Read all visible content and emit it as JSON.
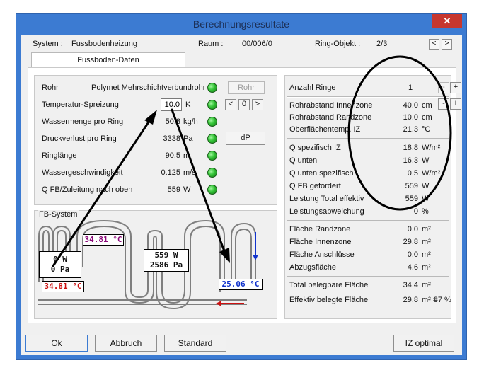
{
  "window": {
    "title": "Berechnungsresultate",
    "close_glyph": "✕"
  },
  "header": {
    "system_label": "System :",
    "system_value": "Fussbodenheizung",
    "raum_label": "Raum :",
    "raum_value": "00/006/0",
    "ring_label": "Ring-Objekt :",
    "ring_value": "2/3",
    "prev_glyph": "<",
    "next_glyph": ">"
  },
  "tab": {
    "label": "Fussboden-Daten"
  },
  "left": {
    "rows": [
      {
        "label": "Rohr",
        "value": "Polymet Mehrschichtverbundrohr",
        "unit": ""
      },
      {
        "label": "Temperatur-Spreizung",
        "value": "10.0",
        "unit": "K"
      },
      {
        "label": "Wassermenge pro Ring",
        "value": "50.8",
        "unit": "kg/h"
      },
      {
        "label": "Druckverlust pro Ring",
        "value": "3338",
        "unit": "Pa"
      },
      {
        "label": "Ringlänge",
        "value": "90.5",
        "unit": "m"
      },
      {
        "label": "Wassergeschwindigkeit",
        "value": "0.125",
        "unit": "m/s"
      },
      {
        "label": "Q FB/Zuleitung nach oben",
        "value": "559",
        "unit": "W"
      }
    ],
    "rohr_button": "Rohr",
    "dp_button": "dP",
    "stepper_value": "0",
    "stepper_left": "<",
    "stepper_right": ">",
    "led_color": "#2fbf2f"
  },
  "fb": {
    "group_label": "FB-System",
    "temp_top": "34.81 °C",
    "left_box": [
      "0 W",
      "0 Pa"
    ],
    "center_box": [
      "559 W",
      "2586 Pa"
    ],
    "temp_left": "34.81 °C",
    "temp_right": "25.06 °C",
    "colors": {
      "pipe": "#7f7f7f",
      "supply": "#cc1111",
      "return": "#1133cc",
      "top_temp": "#8b0a7a"
    }
  },
  "right": {
    "anzahl_label": "Anzahl Ringe",
    "anzahl_value": "1",
    "minus_glyph": "-",
    "plus_glyph": "+",
    "group1": [
      {
        "label": "Rohrabstand Innenzone",
        "value": "40.0",
        "unit": "cm"
      },
      {
        "label": "Rohrabstand Randzone",
        "value": "10.0",
        "unit": "cm"
      },
      {
        "label": "Oberflächentemp. IZ",
        "value": "21.3",
        "unit": "°C"
      }
    ],
    "group2": [
      {
        "label": "Q spezifisch IZ",
        "value": "18.8",
        "unit": "W/m²"
      },
      {
        "label": "Q unten",
        "value": "16.3",
        "unit": "W"
      },
      {
        "label": "Q unten spezifisch",
        "value": "0.5",
        "unit": "W/m²"
      },
      {
        "label": "Q FB gefordert",
        "value": "559",
        "unit": "W"
      },
      {
        "label": "Leistung Total effektiv",
        "value": "559",
        "unit": "W"
      },
      {
        "label": "Leistungsabweichung",
        "value": "0",
        "unit": "%"
      }
    ],
    "group3": [
      {
        "label": "Fläche Randzone",
        "value": "0.0",
        "unit": "m²"
      },
      {
        "label": "Fläche Innenzone",
        "value": "29.8",
        "unit": "m²"
      },
      {
        "label": "Fläche Anschlüsse",
        "value": "0.0",
        "unit": "m²"
      },
      {
        "label": "Abzugsfläche",
        "value": "4.6",
        "unit": "m²"
      }
    ],
    "group4": [
      {
        "label": "Total belegbare Fläche",
        "value": "34.4",
        "unit": "m²"
      },
      {
        "label": "Effektiv belegte Fläche",
        "value": "29.8",
        "unit": "m² =",
        "percent": "87",
        "percent_unit": "%"
      }
    ]
  },
  "buttons": {
    "ok": "Ok",
    "abbruch": "Abbruch",
    "standard": "Standard",
    "iz": "IZ optimal"
  },
  "annotation_color": "#000000"
}
